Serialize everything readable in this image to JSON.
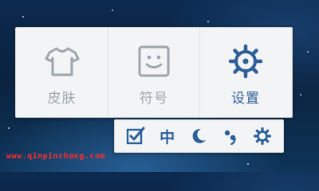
{
  "panel": {
    "tiles": [
      {
        "label": "皮肤",
        "icon": "tshirt-icon",
        "color": "#9ea5ad"
      },
      {
        "label": "符号",
        "icon": "smiley-icon",
        "color": "#9ea5ad"
      },
      {
        "label": "设置",
        "icon": "gear-icon",
        "color": "#2f5f96"
      }
    ]
  },
  "toolbar": {
    "items": [
      {
        "icon": "checkbox-pen-icon"
      },
      {
        "text": "中"
      },
      {
        "icon": "moon-icon"
      },
      {
        "icon": "punctuation-icon"
      },
      {
        "icon": "settings-gear-icon"
      }
    ],
    "accent_color": "#2b5f98"
  },
  "watermark": {
    "text": "www.qinpinchang.com"
  }
}
